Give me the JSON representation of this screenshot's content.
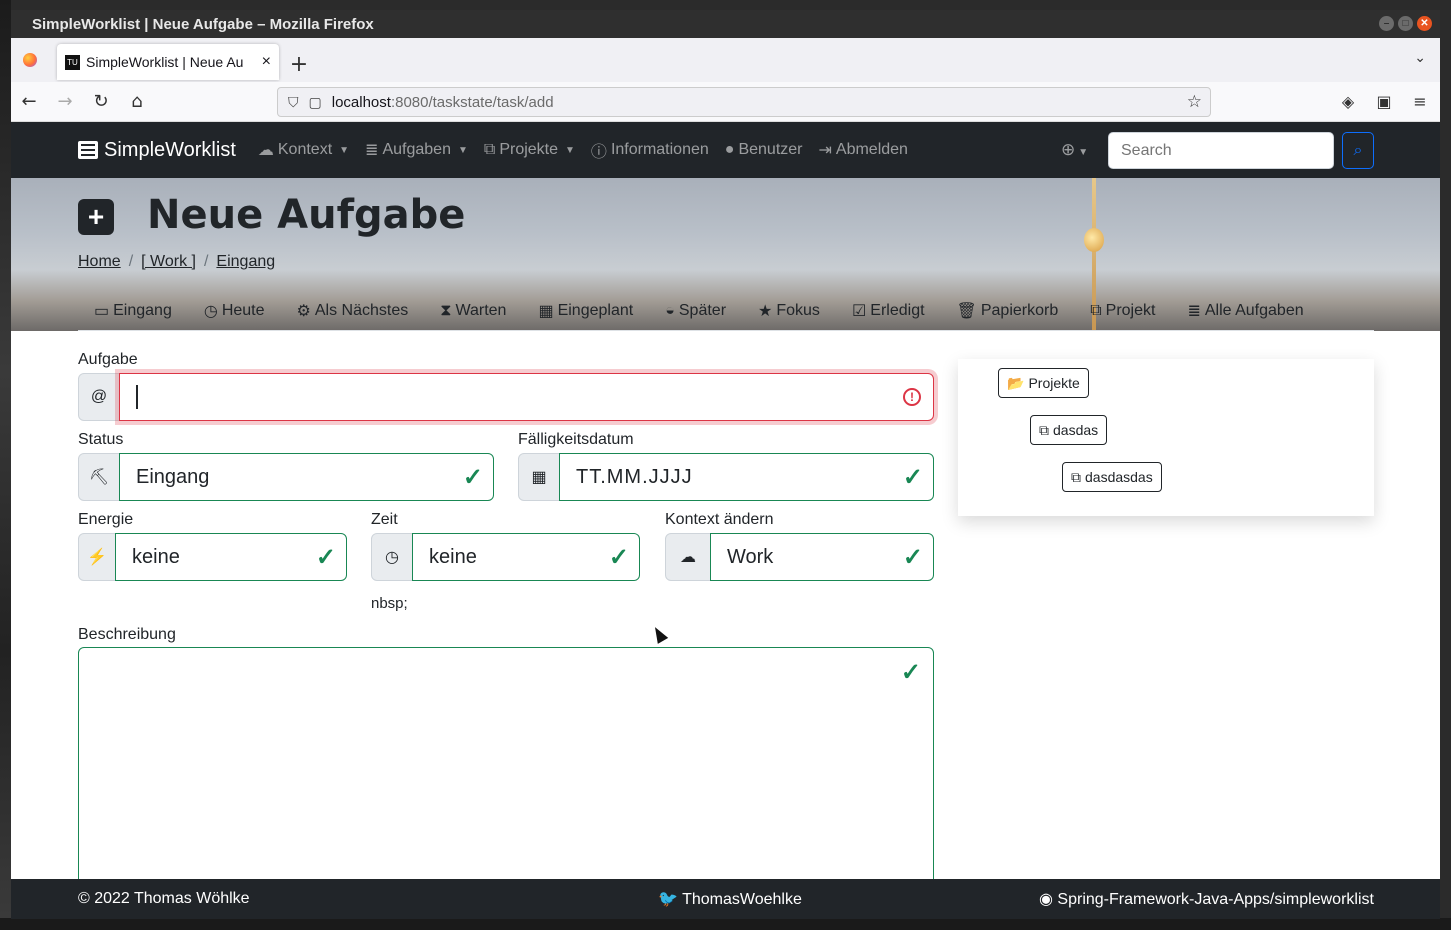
{
  "window": {
    "title": "SimpleWorklist | Neue Aufgabe – Mozilla Firefox"
  },
  "browser": {
    "tab_title": "SimpleWorklist | Neue Au",
    "tab_favicon": "TU",
    "url_host": "localhost",
    "url_path": ":8080/taskstate/task/add"
  },
  "appnav": {
    "brand": "SimpleWorklist",
    "items": [
      {
        "icon": "cloud-icon",
        "label": "Kontext",
        "dropdown": true
      },
      {
        "icon": "database-icon",
        "label": "Aufgaben",
        "dropdown": true
      },
      {
        "icon": "sitemap-icon",
        "label": "Projekte",
        "dropdown": true
      },
      {
        "icon": "info-icon",
        "label": "Informationen",
        "dropdown": false
      },
      {
        "icon": "user-icon",
        "label": "Benutzer",
        "dropdown": false
      },
      {
        "icon": "logout-icon",
        "label": "Abmelden",
        "dropdown": false
      }
    ],
    "search_placeholder": "Search"
  },
  "hero": {
    "title": "Neue Aufgabe",
    "breadcrumb": [
      "Home",
      "[ Work ]",
      "Eingang"
    ]
  },
  "subnav": [
    {
      "icon": "inbox-icon",
      "label": "Eingang"
    },
    {
      "icon": "clock-icon",
      "label": "Heute"
    },
    {
      "icon": "cogs-icon",
      "label": "Als Nächstes"
    },
    {
      "icon": "hourglass-icon",
      "label": "Warten"
    },
    {
      "icon": "calendar-icon",
      "label": "Eingeplant"
    },
    {
      "icon": "binoculars-icon",
      "label": "Später"
    },
    {
      "icon": "star-icon",
      "label": "Fokus"
    },
    {
      "icon": "check-square-icon",
      "label": "Erledigt"
    },
    {
      "icon": "trash-icon",
      "label": "Papierkorb"
    },
    {
      "icon": "sitemap-icon",
      "label": "Projekt"
    },
    {
      "icon": "database-icon",
      "label": "Alle Aufgaben"
    }
  ],
  "form": {
    "task_label": "Aufgabe",
    "task_value": "",
    "status_label": "Status",
    "status_value": "Eingang",
    "due_label": "Fälligkeitsdatum",
    "due_placeholder": "TT.MM.JJJJ",
    "energy_label": "Energie",
    "energy_value": "keine",
    "time_label": "Zeit",
    "time_value": "keine",
    "time_note": "nbsp;",
    "context_label": "Kontext ändern",
    "context_value": "Work",
    "description_label": "Beschreibung"
  },
  "projects_panel": {
    "root": "Projekte",
    "level1": "dasdas",
    "level2": "dasdasdas"
  },
  "footer": {
    "copyright": "© 2022 Thomas Wöhlke",
    "twitter": "ThomasWoehlke",
    "github": "Spring-Framework-Java-Apps/simpleworklist"
  }
}
